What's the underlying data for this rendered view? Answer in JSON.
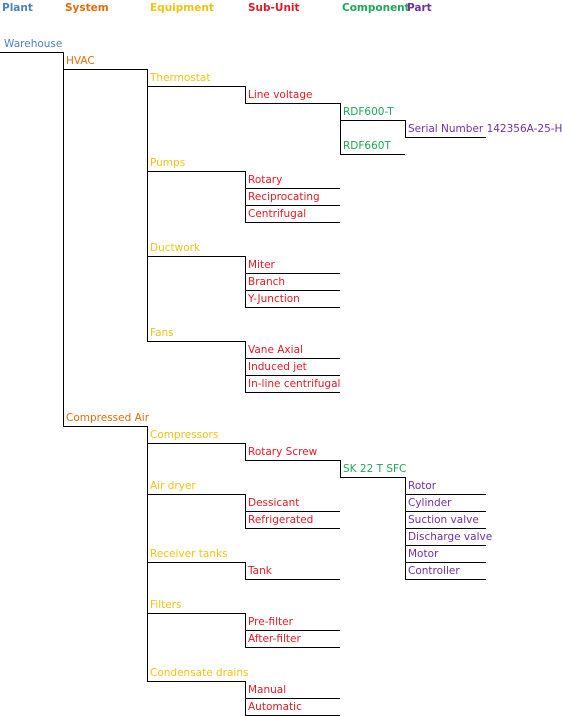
{
  "colors": {
    "plant": "#4f81bd",
    "system": "#e46c0a",
    "equipment": "#f2c314",
    "subunit": "#e01b24",
    "component": "#1fa65a",
    "part": "#7030a0"
  },
  "headers": [
    {
      "level": "plant",
      "label": "Plant"
    },
    {
      "level": "system",
      "label": "System"
    },
    {
      "level": "equipment",
      "label": "Equipment"
    },
    {
      "level": "subunit",
      "label": "Sub-Unit"
    },
    {
      "level": "component",
      "label": "Component"
    },
    {
      "level": "part",
      "label": "Part"
    }
  ],
  "tree": {
    "label": "Warehouse",
    "level": "plant",
    "children": [
      {
        "label": "HVAC",
        "level": "system",
        "children": [
          {
            "label": "Thermostat",
            "level": "equipment",
            "children": [
              {
                "label": "Line voltage",
                "level": "subunit",
                "children": [
                  {
                    "label": "RDF600-T",
                    "level": "component",
                    "children": [
                      {
                        "label": "Serial Number 142356A-25-H",
                        "level": "part",
                        "children": []
                      }
                    ]
                  },
                  {
                    "label": "RDF660T",
                    "level": "component",
                    "children": []
                  }
                ]
              }
            ]
          },
          {
            "label": "Pumps",
            "level": "equipment",
            "children": [
              {
                "label": "Rotary",
                "level": "subunit",
                "children": []
              },
              {
                "label": "Reciprocating",
                "level": "subunit",
                "children": []
              },
              {
                "label": "Centrifugal",
                "level": "subunit",
                "children": []
              }
            ]
          },
          {
            "label": "Ductwork",
            "level": "equipment",
            "children": [
              {
                "label": "Miter",
                "level": "subunit",
                "children": []
              },
              {
                "label": "Branch",
                "level": "subunit",
                "children": []
              },
              {
                "label": "Y-Junction",
                "level": "subunit",
                "children": []
              }
            ]
          },
          {
            "label": "Fans",
            "level": "equipment",
            "children": [
              {
                "label": "Vane Axial",
                "level": "subunit",
                "children": []
              },
              {
                "label": "Induced jet",
                "level": "subunit",
                "children": []
              },
              {
                "label": "In-line centrifugal",
                "level": "subunit",
                "children": []
              }
            ]
          }
        ]
      },
      {
        "label": "Compressed Air",
        "level": "system",
        "children": [
          {
            "label": "Compressors",
            "level": "equipment",
            "children": [
              {
                "label": "Rotary Screw",
                "level": "subunit",
                "children": [
                  {
                    "label": "SK 22 T SFC",
                    "level": "component",
                    "children": [
                      {
                        "label": "Rotor",
                        "level": "part",
                        "children": []
                      },
                      {
                        "label": "Cylinder",
                        "level": "part",
                        "children": []
                      },
                      {
                        "label": "Suction valve",
                        "level": "part",
                        "children": []
                      },
                      {
                        "label": "Discharge valve",
                        "level": "part",
                        "children": []
                      },
                      {
                        "label": "Motor",
                        "level": "part",
                        "children": []
                      },
                      {
                        "label": "Controller",
                        "level": "part",
                        "children": []
                      }
                    ]
                  }
                ]
              }
            ]
          },
          {
            "label": "Air dryer",
            "level": "equipment",
            "children": [
              {
                "label": "Dessicant",
                "level": "subunit",
                "children": []
              },
              {
                "label": "Refrigerated",
                "level": "subunit",
                "children": []
              }
            ]
          },
          {
            "label": "Receiver tanks",
            "level": "equipment",
            "children": [
              {
                "label": "Tank",
                "level": "subunit",
                "children": []
              }
            ]
          },
          {
            "label": "Filters",
            "level": "equipment",
            "children": [
              {
                "label": "Pre-filter",
                "level": "subunit",
                "children": []
              },
              {
                "label": "After-filter",
                "level": "subunit",
                "children": []
              }
            ]
          },
          {
            "label": "Condensate drains",
            "level": "equipment",
            "children": [
              {
                "label": "Manual",
                "level": "subunit",
                "children": []
              },
              {
                "label": "Automatic",
                "level": "subunit",
                "children": []
              }
            ]
          }
        ]
      }
    ]
  }
}
